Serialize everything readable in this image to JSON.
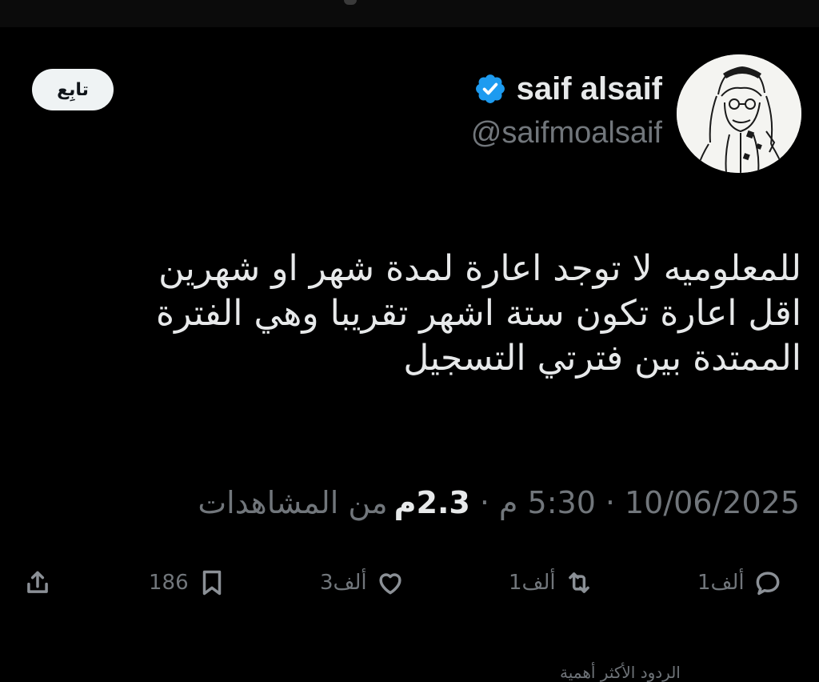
{
  "author": {
    "name": "saif alsaif",
    "handle": "@saifmoalsaif",
    "verified_color": "#1d9bf0"
  },
  "follow_button": {
    "label": "تابِع"
  },
  "tweet": {
    "lines": [
      "للمعلوميه لا توجد اعارة لمدة شهر او شهرين",
      "اقل اعارة تكون ستة اشهر تقريبا وهي الفترة",
      "الممتدة بين فترتي التسجيل"
    ]
  },
  "meta": {
    "date": "10/06/2025",
    "time": "5:30 م",
    "views_count": "2.3م",
    "views_label": "من المشاهدات",
    "separator": "·"
  },
  "actions": {
    "replies": "1ألف",
    "reposts": "1ألف",
    "likes": "3ألف",
    "bookmarks": "186"
  },
  "icons": {
    "reply": "reply-icon",
    "repost": "repost-icon",
    "like": "heart-icon",
    "bookmark": "bookmark-icon",
    "share": "share-icon",
    "verified": "verified-badge-icon"
  },
  "bottom_partial_text": "الردود الأكثر أهمية"
}
